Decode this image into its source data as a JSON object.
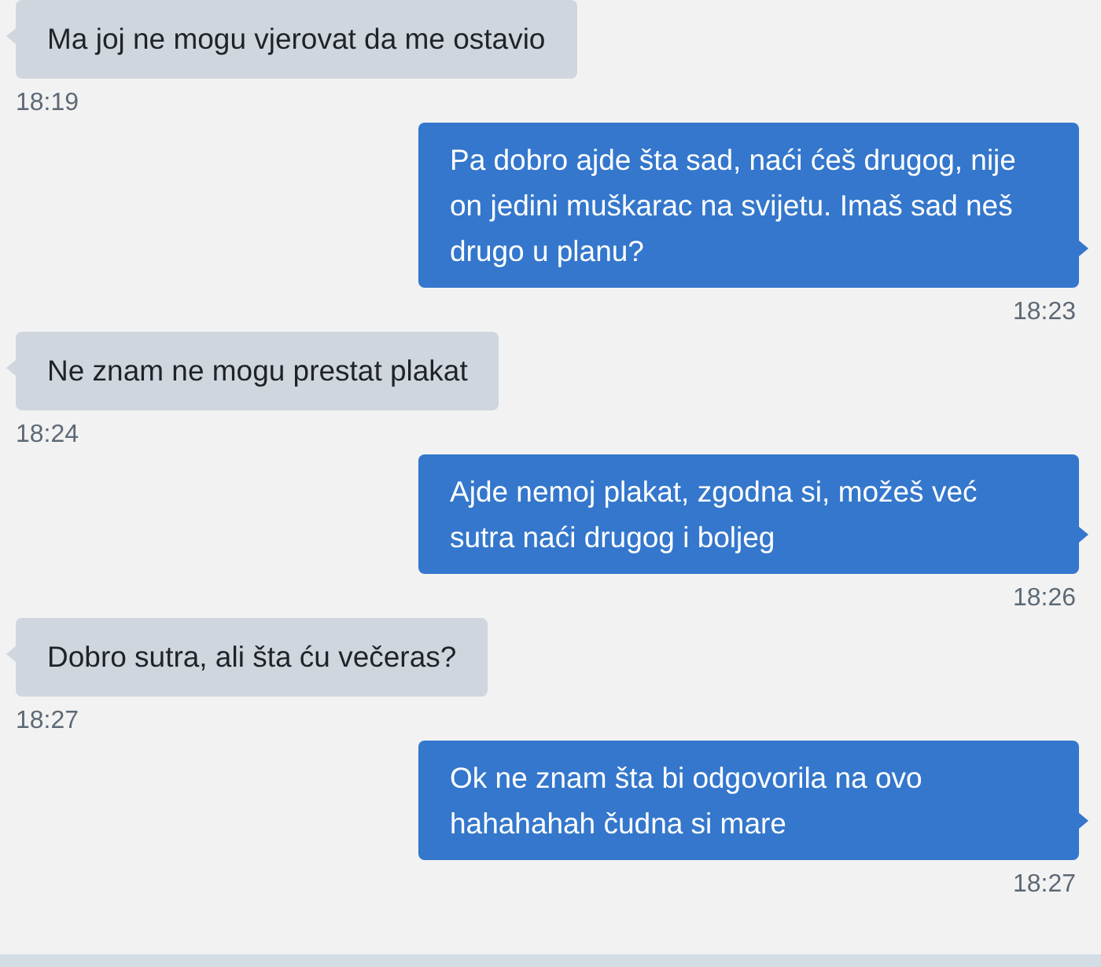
{
  "messages": [
    {
      "kind": "received",
      "text": "Ma joj ne mogu vjerovat da me ostavio",
      "time": "18:19"
    },
    {
      "kind": "sent",
      "text": "Pa dobro ajde šta sad, naći ćeš drugog, nije on jedini muškarac na svijetu. Imaš sad neš drugo u planu?",
      "time": "18:23"
    },
    {
      "kind": "received",
      "text": "Ne znam ne mogu prestat plakat",
      "time": "18:24"
    },
    {
      "kind": "sent",
      "text": "Ajde nemoj plakat, zgodna si, možeš već sutra naći drugog i boljeg",
      "time": "18:26"
    },
    {
      "kind": "received",
      "text": "Dobro sutra, ali šta ću večeras?",
      "time": "18:27"
    },
    {
      "kind": "sent",
      "text": "Ok ne znam šta bi odgovorila na ovo hahahahah čudna si mare",
      "time": "18:27"
    }
  ]
}
